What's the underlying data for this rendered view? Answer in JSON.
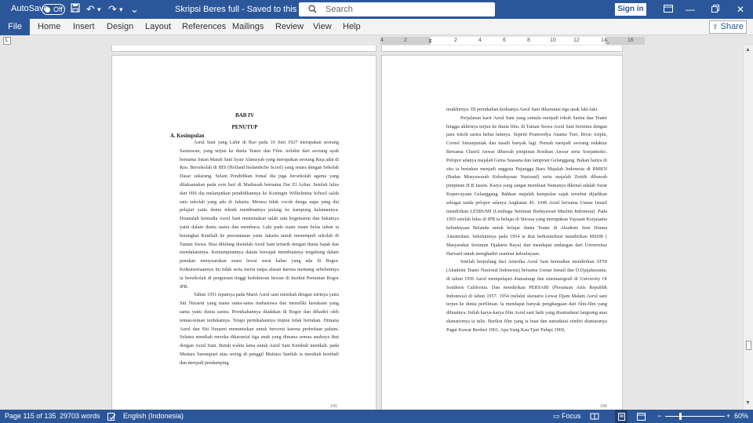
{
  "titlebar": {
    "autosave_label": "AutoSave",
    "autosave_state": "Off",
    "save_icon": "save-icon",
    "undo_icon": "undo-icon",
    "redo_icon": "redo-icon",
    "customize_icon": "customize-icon",
    "doc_title": "Skripsi Beres full  -  Saved to this PC",
    "doc_title_chevron": "⌄",
    "search_placeholder": "Search",
    "signin_label": "Sign in",
    "ribbon_display_icon": "ribbon-display-icon",
    "minimize_icon": "minimize-icon",
    "restore_icon": "restore-icon",
    "close_icon": "close-icon"
  },
  "ribbon": {
    "tabs": [
      "File",
      "Home",
      "Insert",
      "Design",
      "Layout",
      "References",
      "Mailings",
      "Review",
      "View",
      "Help"
    ],
    "share_label": "Share"
  },
  "ruler": {
    "corner": "L",
    "numbers": [
      "4",
      "2",
      "2",
      "4",
      "6",
      "8",
      "10",
      "12",
      "14",
      "16"
    ]
  },
  "pages": {
    "left": {
      "chapter": "BAB IV",
      "title": "PENUTUP",
      "section": "A.   Kesimpulan",
      "paragraphs": [
        "Asrul Sani yang Lahir di Rao pada 10 Juni 1927 merupakan seorang Sastrawan, yang terjun ke dunia Teater dan Film. terlahir dari seorang ayah bernama Sutan Marah Sani Syair Alamsyah yang merupakan seorang Raja adat di Rao. Bersekolah di HIS (Holland Inslandsche Scool) yang setara dengan Sekolah Dasar sekarang. Selain Pendidikan fomal dia juga bersekolah agama yang dilaksanakan pada sore hari di Madrasah bernama Dar El Azhar. Setelah lulus dari HIS dia melanjutkan pendidikannya ke Koningin Wilhelmina School salah satu sekolah yang ada di Jakarta. Merasa tidak cocok denga napa yang dia pelajari yaitu dunia teknik membuatnya pulang ke kampung halamannya. Disanalah kemudia Asrul Sani menemukan salah satu kegemaran dan bakatnya yaitu dalam dunia sastra dan membaca. Lalu pada suatu enam belas tahun ia berangkat Kembali ke peerantauan yaitu Jakarta untuk menempuh sekolah di Taman Siswa. Bisa dibilang disinilah Asrul Sani tertarik dengan dunia Sajak dan mendalaminya. Kemampuannya dalam bersajak membuatnya tergabung dalam pasukan menyuarakan suara lewat surat kabar yang ada di Bogor. Keikutsertaannya itu tidak serta merta tanpa alasan karena memang sebelumnya ia bersekolah di perguruan tinggi kedokteran hewan di Institut Pertanian Bogor IPB.",
        "Tahun 1951 tepatnya pada Maret Asrul sani menikah dengan istrinya yaitu Siti Nuraeni yang mana sama-sama mahasiswa dan memiliki kesukaan yang sama yaitu dunia sastra. Pernikahannya diadakan di Bogor dan dihadiri oleh teman-teman terdekatnya. Tetapi pernikahannya itupun tidak bertahan. Dimana Asrul dan Siti Nuraeni memutuskan untuk bercerai karena perbedaan paham. Selama menikah mereka dikaruniai tiga anak yang dimana semua anaknya ikut dengan Asrul Sani. Butuh waktu lama untuk Asrul Sani Kembali menikah. pada Mutiara Sarumpaet atau sering di panggil Mutiara Sanilah ia menikah kembali dan menjadi pendamping"
      ],
      "page_number": "105"
    },
    "right": {
      "paragraphs": [
        "terakhirnya. Di pernikahan keduanya Asrul Sani dikaruniai tiga anak laki-laki.",
        "Perjalanan karir Asrul Sani yang semula menjadi tokoh Sastra dan Teater hingga akhirnya terjun ke dunia film. di Taman Siswa Asrul Sani bertemu dengan para tokoh sastra hebat lainnya. Seperti Pramoedya Ananta Toer, Rivai Aripin, Cornel Simanjuntak dan masih banyak lagi. Pernah menjadi seorang redaktur Bersama Chairil Anwar dibawah pimpinan Rosihan Anwar serta Soejatmoko. Pelopor adanya majalah Gema Suasana dan lampiran Gelanggang. Bukan hanya di situ ia bertahan menjadi anggota Pujangga Baru Majalah Indonesia di BMKN (Badan Musyawarah Kebudayaan Nasional) serta majalah Zenith dibawah pimpinan H.B Jassin. Karya yang sangat membuat Namanya dikenal adalah Surat Kepercayaan Gelanggang. Bahkan majalah kumpulan sajak tersebut dijadikan sebagai tanda pelopor adanya Angkatan 45. 1949 Asrul bersama Usmar Ismail mendirikan LESBUMI (Lembaga Seniman Budayawan Muslim Indonesia). Pada 1955 setelah lulus di IPB ia belajar di Sticusa yang merupakan Yayasan Kerjasama kebudayaan Belanda untuk belajar dunia Teater di Akademi Seni Drama Amsterdam. Sebelumnya pada 1954 ia ikut berkontribusi mendirikan MSDR ( Masyarakat Seniman Djakarta Raya) dan mendapat undangan dari Universitas Harvard untuk menghadiri seminar kebudayaan.",
        "Setelah berpulang dari Amerika Asrul Sani kemudian mendirikan ATNI (Akademi Teater Nasional Indonesia) bersama Usmar Ismail dan D.Djajakusuma. di tahun 1956 Asrul mempelajari dramaturgi dan sinematografi di University Of Southern California. Dan mendirikan PERSARI (Persatuan Artis Republik Indonesia) di tahun 1957. 1954 melalui skenario Lewat Djam Malam Asrul sani terjun ke dunia perfilman. Ia mendapat banyak penghargaan dari film-film yang dibuatnya. Inilah karya-karya film Asrul sani baik yang disutradarai langsung atau skenarionya ia tulis. Berikut film yang ia buat dan sutradarai sendiri diantaranya Pagar Kawat Berduri 1961, Apa Yang Kau Tjari Palupi 1969,"
      ],
      "page_number": "106"
    }
  },
  "statusbar": {
    "page": "Page 115 of 135",
    "words": "29703 words",
    "proofing_icon": "proofing-icon",
    "language": "English (Indonesia)",
    "focus_icon": "focus-icon",
    "focus_label": "Focus",
    "read_mode_icon": "read-mode-icon",
    "print_layout_icon": "print-layout-icon",
    "web_layout_icon": "web-layout-icon",
    "zoom_minus": "−",
    "zoom_plus": "+",
    "zoom_percent": 60,
    "zoom_label": "60%"
  },
  "colors": {
    "word_blue": "#2b579a",
    "page_bg": "#ffffff",
    "canvas_bg": "#e6e6e6"
  }
}
